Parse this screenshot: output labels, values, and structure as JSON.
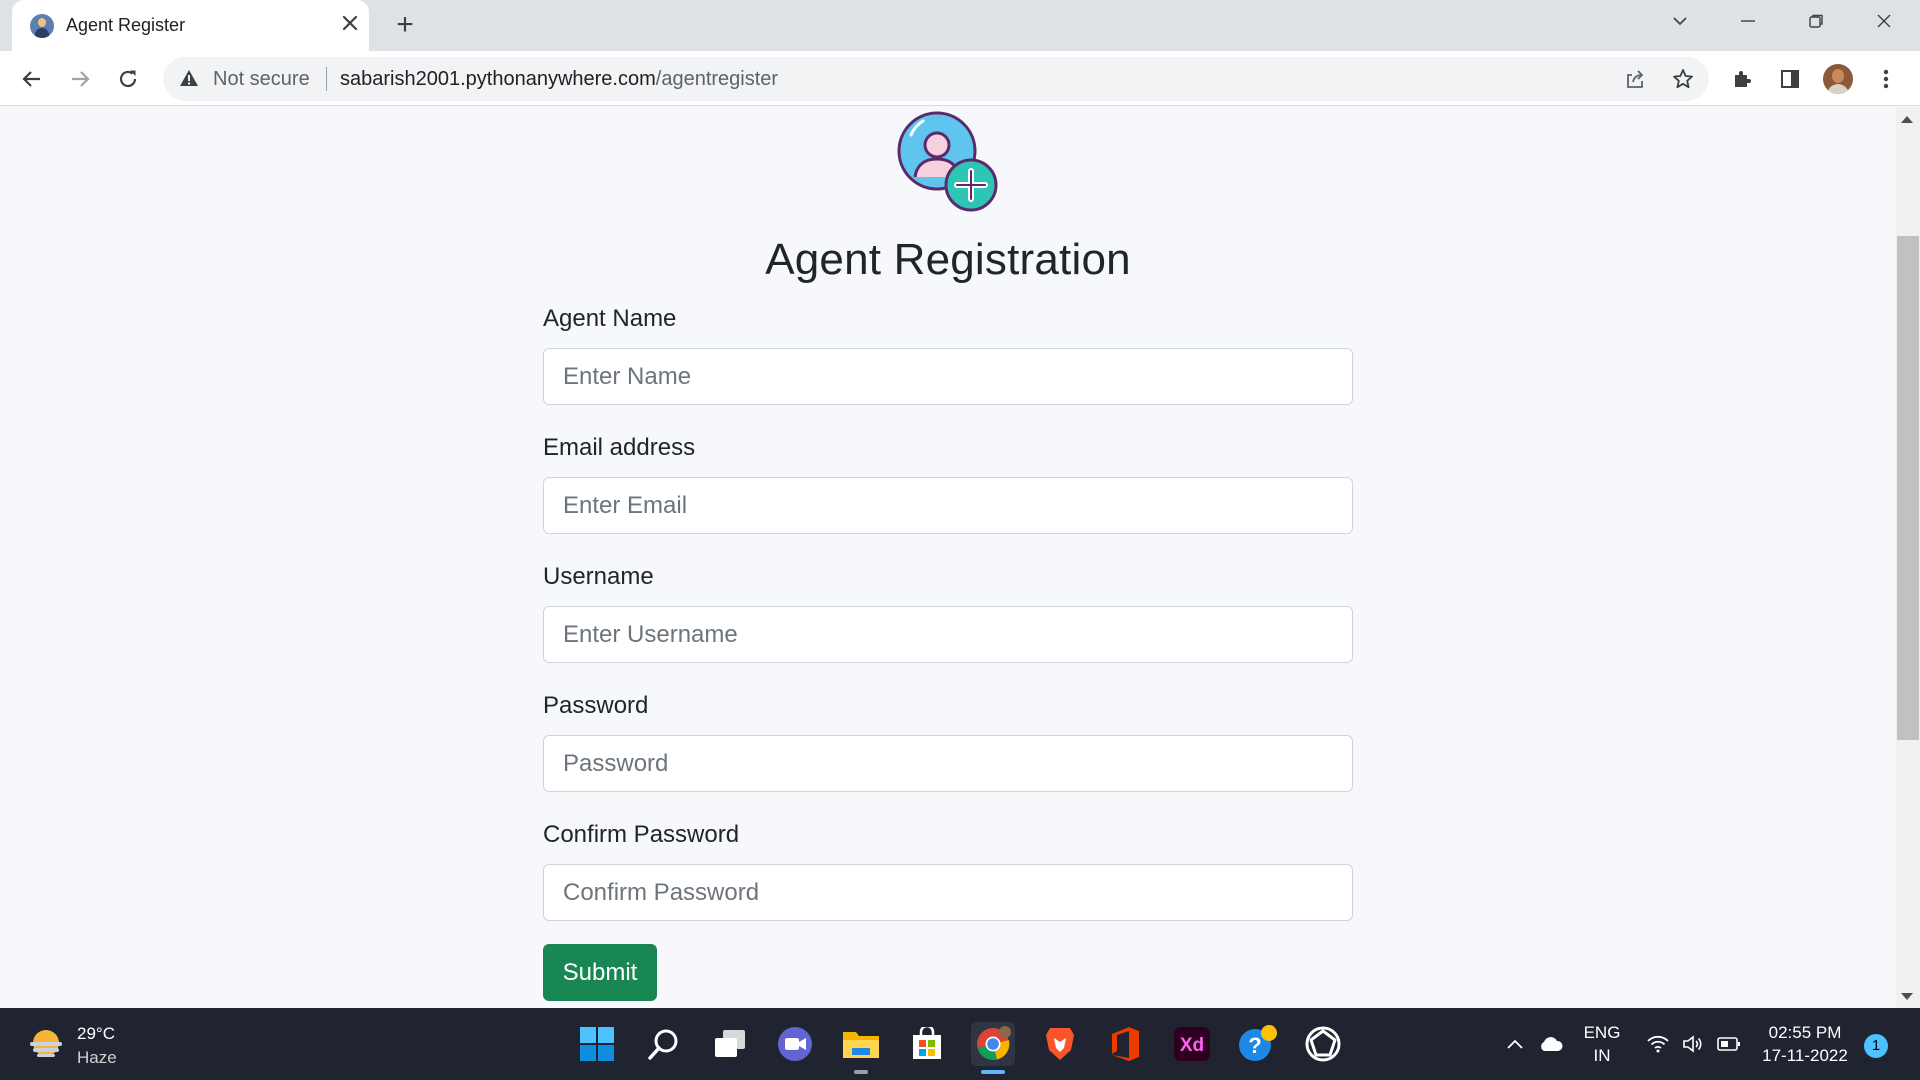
{
  "browser": {
    "tab_title": "Agent Register",
    "new_tab_symbol": "+",
    "close_symbol": "✕",
    "security_label": "Not secure",
    "url_domain": "sabarish2001.pythonanywhere.com",
    "url_path": "/agentregister",
    "icons": [
      "back-icon",
      "forward-icon",
      "reload-icon",
      "warning-icon",
      "share-icon",
      "star-icon",
      "extensions-icon",
      "side-panel-icon",
      "profile-avatar",
      "menu-icon"
    ]
  },
  "page": {
    "title": "Agent Registration",
    "fields": [
      {
        "label": "Agent Name",
        "placeholder": "Enter Name",
        "type": "text"
      },
      {
        "label": "Email address",
        "placeholder": "Enter Email",
        "type": "email"
      },
      {
        "label": "Username",
        "placeholder": "Enter Username",
        "type": "text"
      },
      {
        "label": "Password",
        "placeholder": "Password",
        "type": "password"
      },
      {
        "label": "Confirm Password",
        "placeholder": "Confirm Password",
        "type": "password"
      }
    ],
    "submit_label": "Submit",
    "colors": {
      "submit": "#198754",
      "background": "#f6f8fc",
      "icon_accent": "#2ec4b6"
    }
  },
  "taskbar": {
    "weather_temp": "29°C",
    "weather_desc": "Haze",
    "apps": [
      "windows-start",
      "search",
      "task-view",
      "teams-meet",
      "file-explorer",
      "microsoft-store",
      "chrome",
      "brave",
      "office",
      "adobe-xd",
      "help",
      "ubuntu-app"
    ],
    "xd_label": "Xd",
    "lang_top": "ENG",
    "lang_bottom": "IN",
    "time": "02:55 PM",
    "date": "17-11-2022",
    "notification_count": "1"
  }
}
